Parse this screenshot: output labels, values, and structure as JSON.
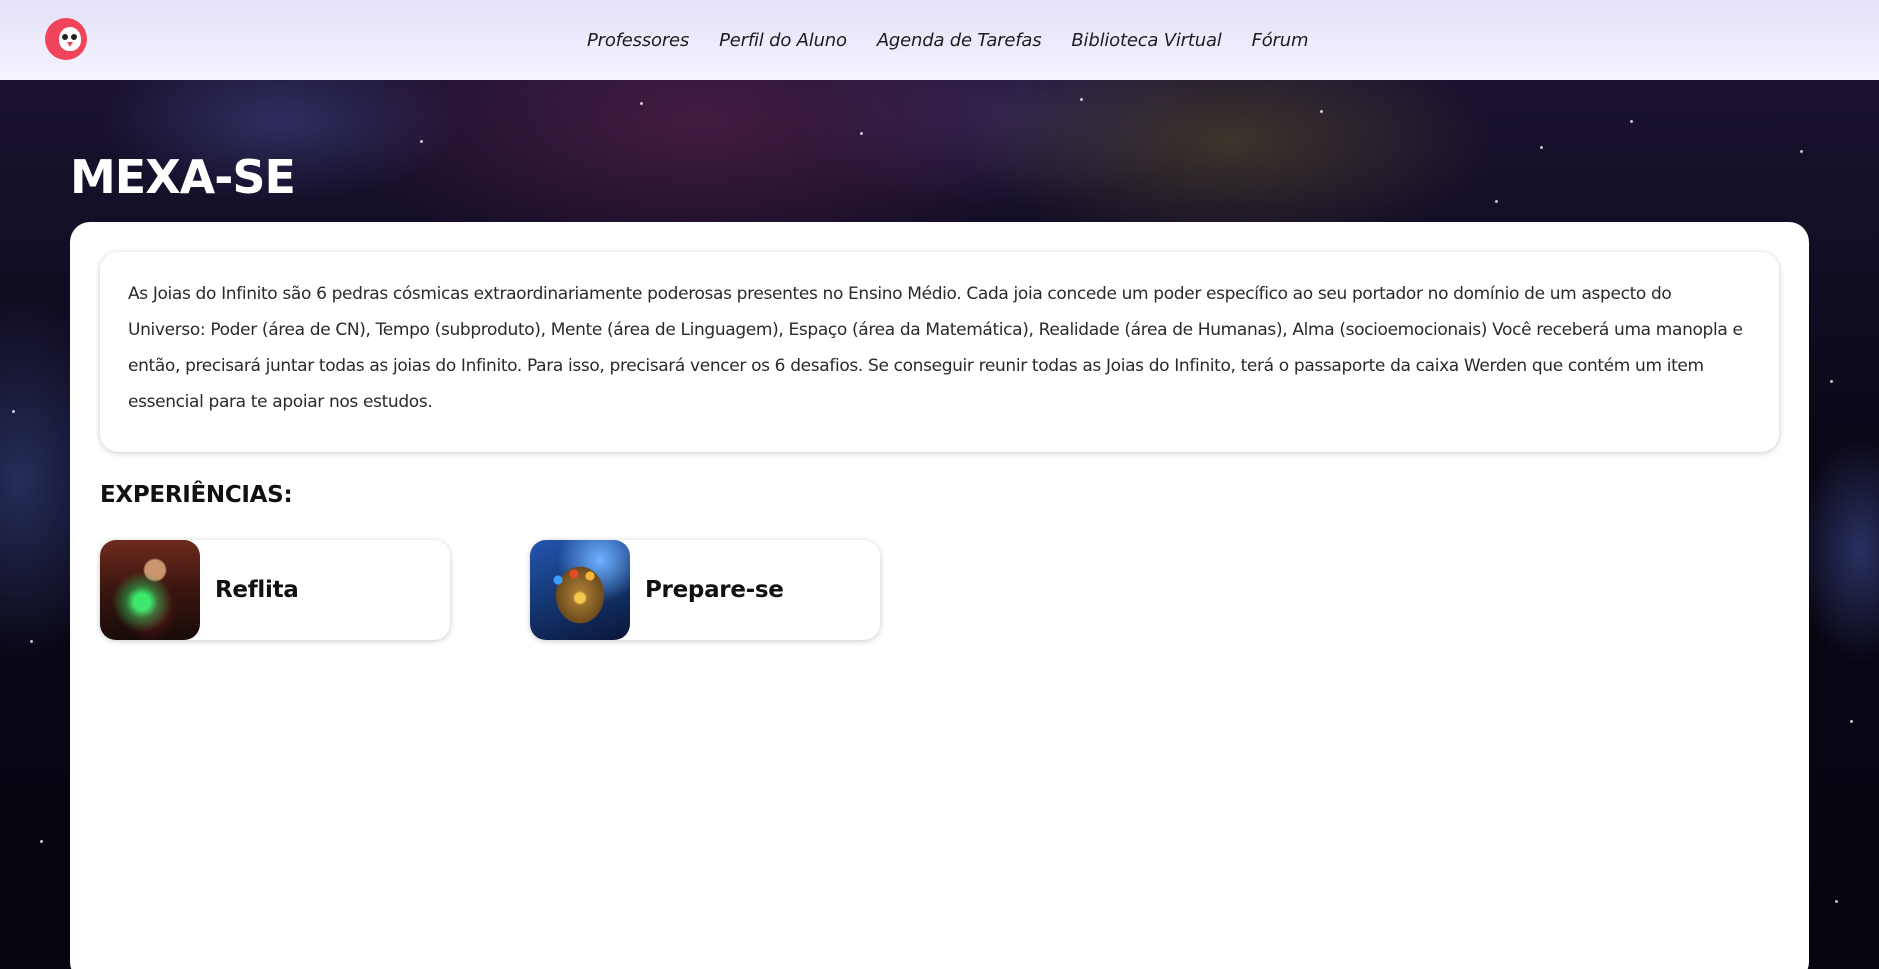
{
  "header": {
    "logo_icon": "owl-logo-icon",
    "nav": [
      {
        "label": "Professores"
      },
      {
        "label": "Perfil do Aluno"
      },
      {
        "label": "Agenda de Tarefas"
      },
      {
        "label": "Biblioteca Virtual"
      },
      {
        "label": "Fórum"
      }
    ]
  },
  "page": {
    "title": "MEXA-SE"
  },
  "intro": {
    "text": "As Joias do Infinito são 6 pedras cósmicas extraordinariamente poderosas presentes no Ensino Médio. Cada joia concede um poder específico ao seu portador no domínio de um aspecto do Universo: Poder (área de CN), Tempo (subproduto), Mente (área de Linguagem), Espaço (área da Matemática), Realidade (área de Humanas), Alma (socioemocionais) Você receberá uma manopla e então, precisará juntar todas as joias do Infinito. Para isso, precisará vencer os 6 desafios. Se conseguir reunir todas as Joias do Infinito, terá o passaporte da caixa Werden que contém um item essencial para te apoiar nos estudos."
  },
  "experiences": {
    "title": "EXPERIÊNCIAS:",
    "items": [
      {
        "label": "Reflita",
        "image": "sorcerer-green-glow-thumbnail"
      },
      {
        "label": "Prepare-se",
        "image": "infinity-gauntlet-thumbnail"
      }
    ]
  },
  "colors": {
    "header_bg": "#e4e1fa",
    "logo": "#f0445a",
    "panel_bg": "#ffffff",
    "title": "#ffffff"
  }
}
